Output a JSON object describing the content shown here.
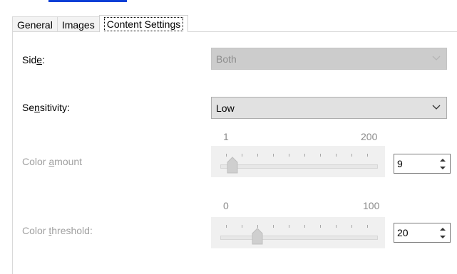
{
  "tabs": [
    {
      "label": "General",
      "active": false
    },
    {
      "label": "Images",
      "active": false
    },
    {
      "label": "Content Settings",
      "active": true
    }
  ],
  "side": {
    "label_pre": "Sid",
    "label_u": "e",
    "label_post": ":",
    "value": "Both",
    "enabled": false
  },
  "sensitivity": {
    "label_pre": "Se",
    "label_u": "n",
    "label_post": "sitivity:",
    "value": "Low",
    "enabled": true
  },
  "color_amount": {
    "label_pre": "Color ",
    "label_u": "a",
    "label_post": "mount",
    "min": "1",
    "max": "200",
    "value": "9",
    "enabled": false
  },
  "color_threshold": {
    "label_pre": "Color ",
    "label_u": "t",
    "label_post": "hreshold:",
    "min": "0",
    "max": "100",
    "value": "20",
    "enabled": false
  },
  "colors": {
    "link": "#0a3fd6",
    "disabled_text": "#a0a0a0",
    "panel_bg": "#f0f0f0"
  }
}
